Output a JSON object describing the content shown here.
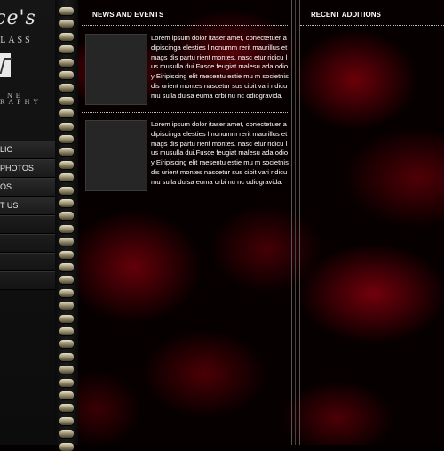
{
  "brand": {
    "name": "ace's",
    "subtitle": "GLASS",
    "tagline_line1": "NE",
    "tagline_line2": "RAPHY"
  },
  "menu": {
    "items": [
      "LIO",
      "PHOTOS",
      "OS",
      "T US",
      "",
      "",
      "",
      ""
    ]
  },
  "news": {
    "title": "NEWS AND EVENTS",
    "items": [
      {
        "text": "Lorem ipsum dolor itaser amet, conectetuer adipiscinga elesties l nonumm rerit maurillus et mags dis partu rient montes. nasc etur ridicu lus musulla dui.Fusce feugiat malesu ada odioy Eiripiscing elit raesentu estie mu m societnis dis urient montes nascetur sus cipit vari ridicumu sulla duisa euma orbi nu nc odiogravida."
      },
      {
        "text": "Lorem ipsum dolor itaser amet, conectetuer adipiscinga elesties l nonumm rerit maurillus et mags dis partu rient montes. nasc etur ridicu lus musulla dui.Fusce feugiat malesu ada odioy Eiripiscing elit raesentu estie mu m societnis dis urient montes nascetur sus cipit vari ridicumu sulla duisa euma orbi nu nc odiogravida."
      }
    ]
  },
  "recent": {
    "title": "RECENT ADDITIONS"
  },
  "colors": {
    "background": "#070000",
    "accent_red": "#8c000a",
    "text": "#ffffff",
    "ring": "#c8bd95"
  }
}
